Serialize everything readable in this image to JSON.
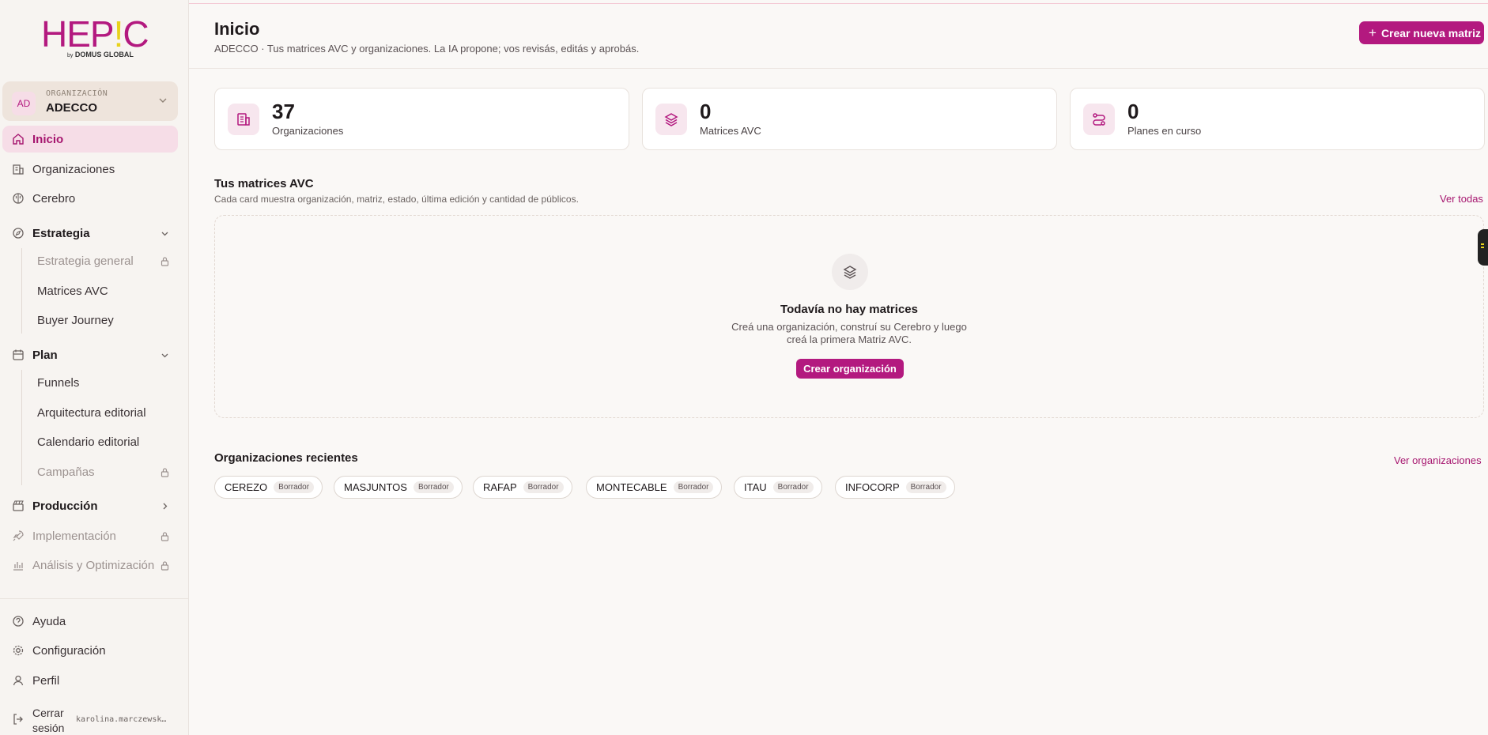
{
  "brand": {
    "logo_pre": "HEP",
    "logo_mark": "!",
    "logo_post": "C",
    "logo_by": "by",
    "logo_sub": "DOMUS GLOBAL"
  },
  "org": {
    "initials": "AD",
    "label": "ORGANIZACIÓN",
    "name": "ADECCO"
  },
  "nav": {
    "inicio": "Inicio",
    "organizaciones": "Organizaciones",
    "cerebro": "Cerebro",
    "estrategia": "Estrategia",
    "estrategia_general": "Estrategia general",
    "matrices_avc": "Matrices AVC",
    "buyer_journey": "Buyer Journey",
    "plan": "Plan",
    "funnels": "Funnels",
    "arquitectura": "Arquitectura editorial",
    "calendario": "Calendario editorial",
    "campanas": "Campañas",
    "produccion": "Producción",
    "implementacion": "Implementación",
    "analisis": "Análisis y Optimización",
    "ayuda": "Ayuda",
    "configuracion": "Configuración",
    "perfil": "Perfil",
    "cerrar_1": "Cerrar",
    "cerrar_2": "sesión",
    "user_email": "karolina.marczewsk…"
  },
  "header": {
    "title": "Inicio",
    "subtitle": "ADECCO · Tus matrices AVC y organizaciones. La IA propone; vos revisás, editás y aprobás.",
    "new_button": "Crear nueva matriz"
  },
  "stats": [
    {
      "value": "37",
      "label": "Organizaciones",
      "icon": "building-icon"
    },
    {
      "value": "0",
      "label": "Matrices AVC",
      "icon": "layers-icon"
    },
    {
      "value": "0",
      "label": "Planes en curso",
      "icon": "route-icon"
    }
  ],
  "matrices": {
    "title": "Tus matrices AVC",
    "subtitle": "Cada card muestra organización, matriz, estado, última edición y cantidad de públicos.",
    "link": "Ver todas",
    "empty_title": "Todavía no hay matrices",
    "empty_line1": "Creá una organización, construí su Cerebro y luego",
    "empty_line2": "creá la primera Matriz AVC.",
    "empty_button": "Crear organización"
  },
  "recientes": {
    "title": "Organizaciones recientes",
    "link": "Ver organizaciones",
    "items": [
      {
        "name": "CEREZO",
        "status": "Borrador"
      },
      {
        "name": "MASJUNTOS",
        "status": "Borrador"
      },
      {
        "name": "RAFAP",
        "status": "Borrador"
      },
      {
        "name": "MONTECABLE",
        "status": "Borrador"
      },
      {
        "name": "ITAU",
        "status": "Borrador"
      },
      {
        "name": "INFOCORP",
        "status": "Borrador"
      }
    ]
  },
  "colors": {
    "accent": "#b3197f",
    "accent_soft": "#f6dde7",
    "logo_mark": "#e8d21c"
  }
}
